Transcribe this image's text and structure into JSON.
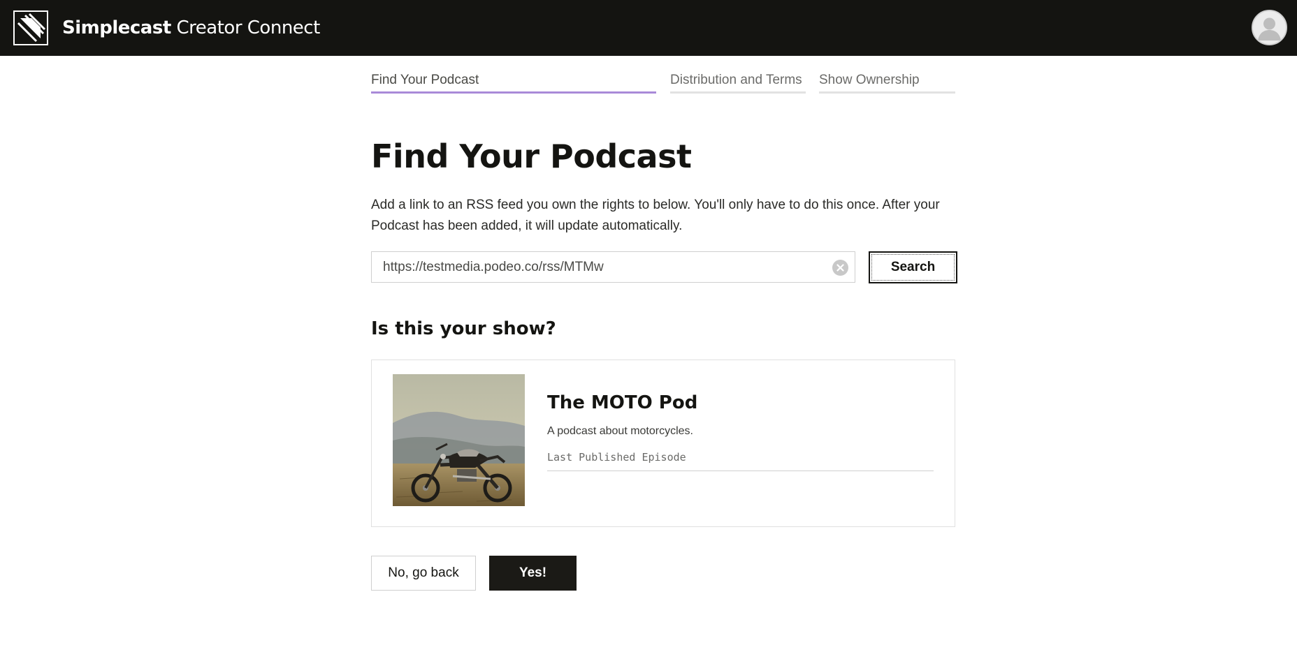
{
  "header": {
    "brand_strong": "Simplecast",
    "brand_light": "Creator Connect",
    "logo_icon": "simplecast-logo-icon",
    "avatar_icon": "user-avatar-icon",
    "background_color": "#141411"
  },
  "steps": [
    {
      "label": "Find Your Podcast",
      "active": true
    },
    {
      "label": "Distribution and Terms",
      "active": false
    },
    {
      "label": "Show Ownership",
      "active": false
    }
  ],
  "main": {
    "title": "Find Your Podcast",
    "intro": "Add a link to an RSS feed you own the rights to below. You'll only have to do this once. After your Podcast has been added, it will update automatically.",
    "search": {
      "value": "https://testmedia.podeo.co/rss/MTMw",
      "button_label": "Search",
      "clear_icon": "clear-circle-icon"
    },
    "confirm_heading": "Is this your show?"
  },
  "show": {
    "title": "The MOTO Pod",
    "description": "A podcast about motorcycles.",
    "meta_label": "Last Published Episode",
    "cover_description": "motorcycle-cover-image"
  },
  "actions": {
    "back_label": "No, go back",
    "confirm_label": "Yes!"
  },
  "colors": {
    "accent": "#a98ad8",
    "primary_button": "#1b1a16"
  }
}
